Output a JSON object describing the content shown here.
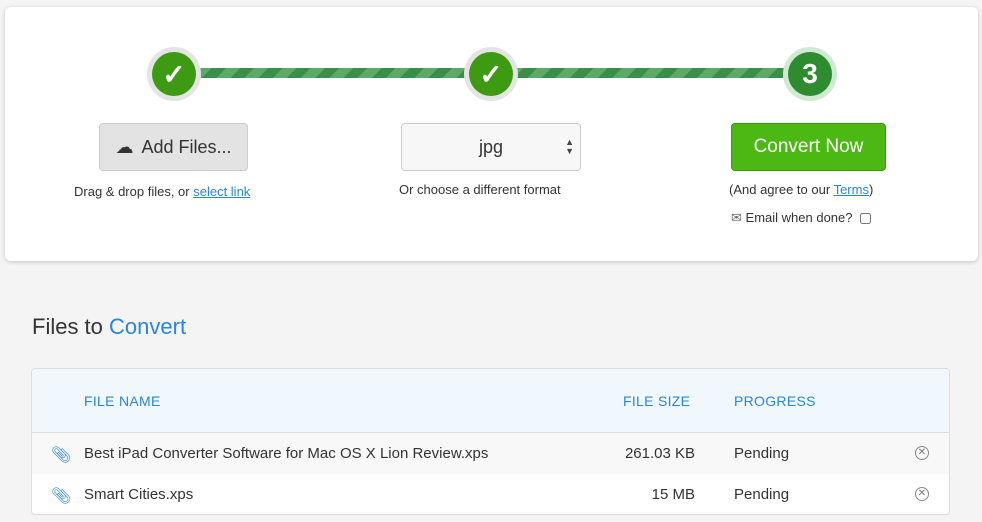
{
  "steps": [
    {
      "state": "done",
      "icon": "check-icon"
    },
    {
      "state": "done",
      "icon": "check-icon"
    },
    {
      "state": "current",
      "label": "3"
    }
  ],
  "add_files": {
    "label": "Add Files...",
    "icon": "cloud-upload-icon",
    "hint": "Drag & drop files, or ",
    "link": "select link"
  },
  "format": {
    "value": "jpg",
    "hint": "Or choose a different format"
  },
  "convert": {
    "label": "Convert Now",
    "agree_prefix": "(And agree to our ",
    "terms": "Terms",
    "agree_suffix": ")",
    "email_label": "Email when done?",
    "email_checked": false
  },
  "section": {
    "title_a": "Files to ",
    "title_b": "Convert"
  },
  "table": {
    "headers": {
      "name": "FILE NAME",
      "size": "FILE SIZE",
      "progress": "PROGRESS"
    },
    "rows": [
      {
        "name": "Best iPad Converter Software for Mac OS X Lion Review.xps",
        "size": "261.03 KB",
        "progress": "Pending"
      },
      {
        "name": "Smart Cities.xps",
        "size": "15 MB",
        "progress": "Pending"
      }
    ]
  },
  "colors": {
    "accent": "#2b86d8",
    "convert": "#4cb814",
    "step": "#3d9a12"
  }
}
